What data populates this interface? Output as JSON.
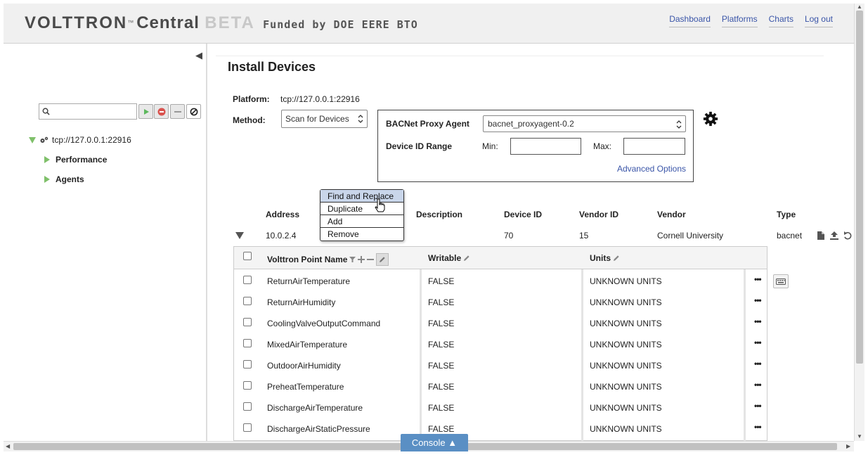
{
  "header": {
    "brand_volttron": "VOLTTRON",
    "brand_tm": "™",
    "brand_central": "Central",
    "brand_beta": "BETA",
    "brand_funded": "Funded by DOE EERE BTO",
    "nav": [
      "Dashboard",
      "Platforms",
      "Charts",
      "Log out"
    ]
  },
  "sidebar": {
    "collapse_glyph": "◀",
    "search": {
      "value": "",
      "placeholder": ""
    },
    "platform": "tcp://127.0.0.1:22916",
    "items": [
      "Performance",
      "Agents"
    ]
  },
  "main": {
    "title": "Install Devices",
    "platform_label": "Platform:",
    "platform_value": "tcp://127.0.0.1:22916",
    "method_label": "Method:",
    "method_value": "Scan for Devices",
    "proxy_label": "BACNet Proxy Agent",
    "proxy_value": "bacnet_proxyagent-0.2",
    "range_label": "Device ID Range",
    "min_label": "Min:",
    "min_value": "",
    "max_label": "Max:",
    "max_value": "",
    "advanced": "Advanced Options"
  },
  "context_menu": {
    "items": [
      "Find and Replace",
      "Duplicate",
      "Add",
      "Remove"
    ],
    "active_index": 0
  },
  "device_table": {
    "headers": {
      "address": "Address",
      "description": "Description",
      "device_id": "Device ID",
      "vendor_id": "Vendor ID",
      "vendor": "Vendor",
      "type": "Type"
    },
    "row": {
      "address": "10.0.2.4",
      "description": "",
      "device_id": "70",
      "vendor_id": "15",
      "vendor": "Cornell University",
      "type": "bacnet"
    }
  },
  "points_table": {
    "headers": {
      "name": "Volttron Point Name",
      "writable": "Writable",
      "units": "Units"
    },
    "rows": [
      {
        "name": "ReturnAirTemperature",
        "writable": "FALSE",
        "units": "UNKNOWN UNITS"
      },
      {
        "name": "ReturnAirHumidity",
        "writable": "FALSE",
        "units": "UNKNOWN UNITS"
      },
      {
        "name": "CoolingValveOutputCommand",
        "writable": "FALSE",
        "units": "UNKNOWN UNITS"
      },
      {
        "name": "MixedAirTemperature",
        "writable": "FALSE",
        "units": "UNKNOWN UNITS"
      },
      {
        "name": "OutdoorAirHumidity",
        "writable": "FALSE",
        "units": "UNKNOWN UNITS"
      },
      {
        "name": "PreheatTemperature",
        "writable": "FALSE",
        "units": "UNKNOWN UNITS"
      },
      {
        "name": "DischargeAirTemperature",
        "writable": "FALSE",
        "units": "UNKNOWN UNITS"
      },
      {
        "name": "DischargeAirStaticPressure",
        "writable": "FALSE",
        "units": "UNKNOWN UNITS"
      }
    ],
    "row_menu": "•••"
  },
  "console": {
    "label": "Console ▲"
  },
  "colors": {
    "link": "#3a55a8",
    "tree_arrow": "#7fc06a",
    "console": "#5a8fc4",
    "menu_active": "#c9d6ea"
  }
}
